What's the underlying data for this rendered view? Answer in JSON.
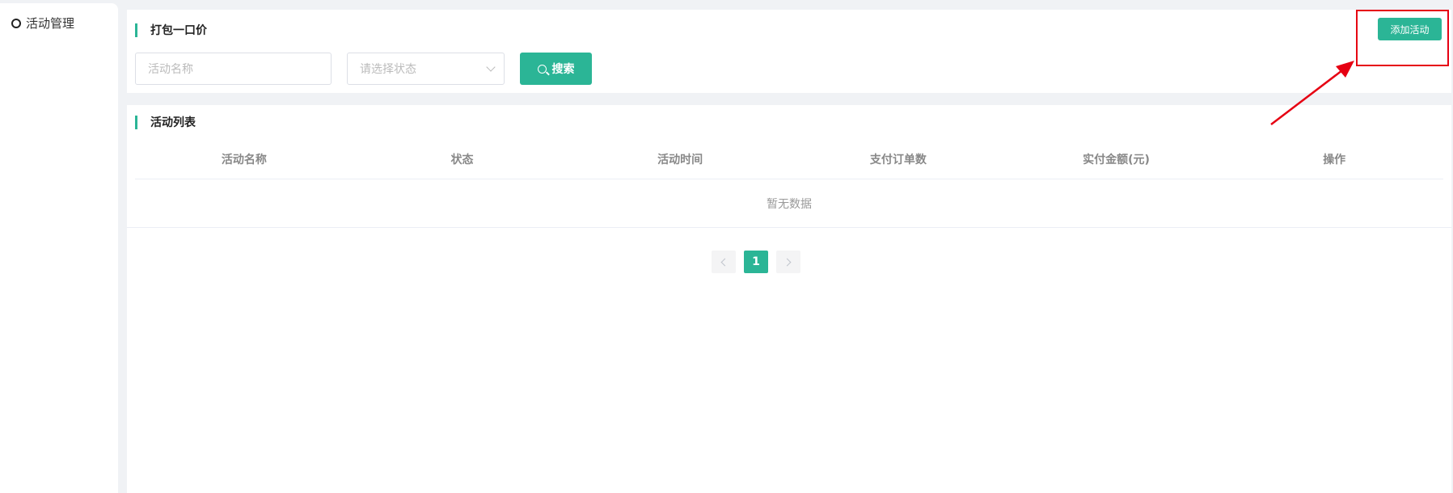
{
  "sidebar": {
    "items": [
      {
        "label": "活动管理",
        "icon": "circle-icon"
      }
    ]
  },
  "search_panel": {
    "title": "打包一口价",
    "name_placeholder": "活动名称",
    "status_placeholder": "请选择状态",
    "search_label": "搜索",
    "add_label": "添加活动"
  },
  "list_panel": {
    "title": "活动列表",
    "columns": [
      "活动名称",
      "状态",
      "活动时间",
      "支付订单数",
      "实付金额(元)",
      "操作"
    ],
    "empty_text": "暂无数据"
  },
  "pagination": {
    "current_page": "1"
  },
  "colors": {
    "accent": "#2bb596",
    "annotation": "#e60012"
  }
}
